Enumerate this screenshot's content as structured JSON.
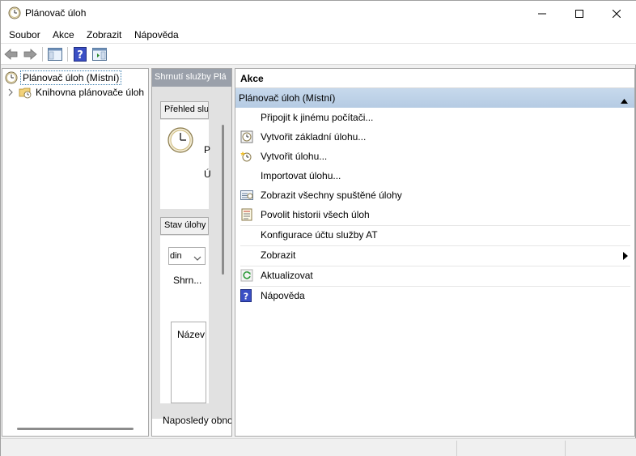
{
  "window": {
    "title": "Plánovač úloh"
  },
  "menu": {
    "items": [
      "Soubor",
      "Akce",
      "Zobrazit",
      "Nápověda"
    ]
  },
  "tree": {
    "root_label": "Plánovač úloh (Místní)",
    "child_label": "Knihovna plánovače úloh"
  },
  "middle": {
    "header": "Shrnutí služby Plá",
    "overview_button": "Přehled služby",
    "overview_text_1": "P",
    "overview_text_2": "Ú",
    "status_button": "Stav úlohy",
    "dropdown_value": "din",
    "summary_text": "Shrn...",
    "name_column": "Název",
    "last_refresh": "Naposledy obno"
  },
  "actions": {
    "header": "Akce",
    "section_title": "Plánovač úloh (Místní)",
    "items": [
      {
        "label": "Připojit k jinému počítači...",
        "icon": "none"
      },
      {
        "label": "Vytvořit základní úlohu...",
        "icon": "basic-task-icon"
      },
      {
        "label": "Vytvořit úlohu...",
        "icon": "create-task-icon"
      },
      {
        "label": "Importovat úlohu...",
        "icon": "none"
      },
      {
        "label": "Zobrazit všechny spuštěné úlohy",
        "icon": "running-tasks-icon"
      },
      {
        "label": "Povolit historii všech úloh",
        "icon": "history-icon"
      },
      {
        "label": "Konfigurace účtu služby AT",
        "icon": "none"
      },
      {
        "label": "Zobrazit",
        "icon": "none"
      },
      {
        "label": "Aktualizovat",
        "icon": "refresh-icon"
      },
      {
        "label": "Nápověda",
        "icon": "help-icon"
      }
    ]
  },
  "colors": {
    "section_bg": "#c0d4ea",
    "mid_header_bg": "#9aa0aa",
    "help_blue": "#3a4fc4"
  }
}
